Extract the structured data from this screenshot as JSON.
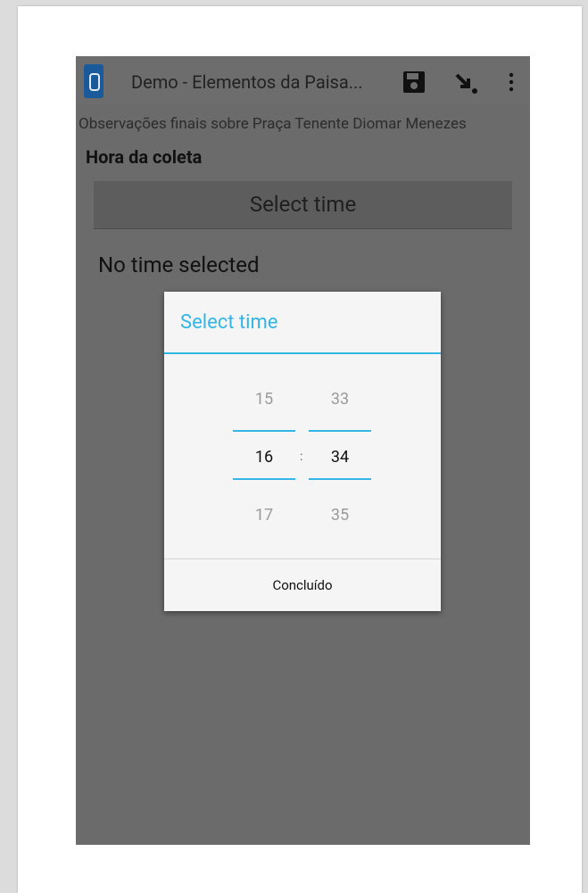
{
  "app": {
    "title": "Demo - Elementos da Paisa...",
    "icons": {
      "save": "save-icon",
      "move": "arrow-down-right-icon",
      "more": "more-vert-icon"
    }
  },
  "form": {
    "subtitle": "Observações finais sobre Praça Tenente Diomar Menezes",
    "question_label": "Hora da coleta",
    "select_button_label": "Select time",
    "status_text": "No time selected"
  },
  "dialog": {
    "title": "Select time",
    "hour": {
      "prev": "15",
      "current": "16",
      "next": "17"
    },
    "separator": ":",
    "minute": {
      "prev": "33",
      "current": "34",
      "next": "35"
    },
    "done_label": "Concluído"
  },
  "colors": {
    "accent": "#33b5e5",
    "overlay": "#6b6b6b",
    "dialog_bg": "#f5f5f5"
  }
}
